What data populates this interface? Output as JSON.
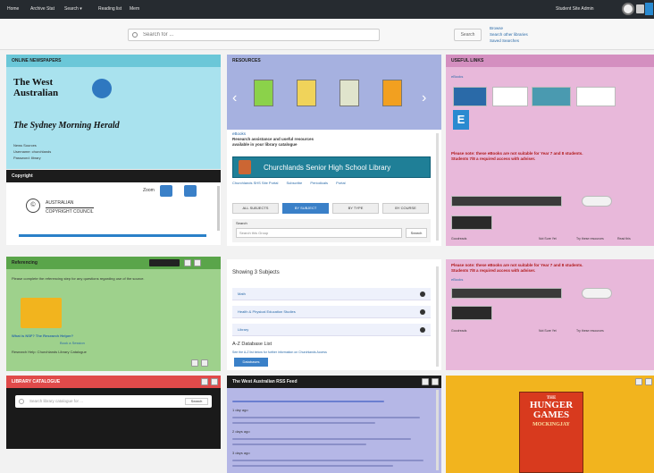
{
  "topbar": {
    "nav": [
      "Home",
      "Archive Stat",
      "Search ▾",
      "Reading list",
      "Mem"
    ],
    "right_text": "Student Site Admin"
  },
  "search": {
    "placeholder": "Search for ...",
    "button": "Search",
    "links": [
      "Browse",
      "Search other libraries",
      "Saved Searches"
    ]
  },
  "panels": {
    "newspapers": {
      "title": "ONLINE NEWSPAPERS",
      "logo1": "The West Australian",
      "logo2": "The Sydney Morning Herald",
      "lines": [
        "News Sources",
        "Username: churchlands",
        "Password: library"
      ]
    },
    "copyright": {
      "title": "Copyright",
      "zoom": "Zoom",
      "agency_line1": "AUSTRALIAN",
      "agency_line2": "COPYRIGHT COUNCIL"
    },
    "resources": {
      "title": "RESOURCES",
      "section": "eBooks",
      "sub1": "Research assistance and useful resources",
      "sub2": "available in your library catalogue",
      "library_name": "Churchlands Senior High School Library",
      "library_links": [
        "Churchlands SHS Site Portal",
        "Subscribe",
        "Periodicals",
        "Portal"
      ],
      "tabs": [
        "ALL SUBJECTS",
        "BY SUBJECT",
        "BY TYPE",
        "BY COURSE"
      ],
      "search_label": "Search",
      "search_placeholder": "Search this Group",
      "search_button": "Search"
    },
    "subjects": {
      "heading": "Showing 3 Subjects",
      "items": [
        "Math",
        "Health & Physical Education Studies",
        "Library"
      ],
      "az_title": "A-Z Database List",
      "az_line": "See the A-Z list below for further information on Churchlands Access",
      "az_button": "Databases"
    },
    "ebooks": {
      "title": "USEFUL LINKS",
      "link": "eBooks",
      "red_lines": [
        "Please note: these eBooks are not suitable for Year 7 and 8 students.",
        "Students 7/8 a required access with adviser."
      ],
      "bottom_labels": [
        "Goodreads",
        "Not Sure Yet",
        "Try these resources",
        "Read this"
      ]
    },
    "ebooks2": {
      "red_lines": [
        "Please note: these eBooks are not suitable for Year 7 and 8 students.",
        "Students 7/8 a required access with adviser."
      ],
      "link": "eBooks",
      "bottom_labels": [
        "Goodreads",
        "Not Sure Yet",
        "Try these resources"
      ]
    },
    "referencing": {
      "title": "Referencing",
      "line1": "Please complete the referencing step for any questions regarding use of the source.",
      "link": "What is NSF? The Research Helper?",
      "link2": "Book a Session",
      "line2": "Research Help: Churchlands Library Catalogue"
    },
    "catalogue": {
      "title": "LIBRARY CATALOGUE",
      "placeholder": "Search library catalogue for ...",
      "button": "Search"
    },
    "rss": {
      "title": "The West Australian RSS Feed",
      "items": [
        "1 day ago",
        "2 days ago",
        "3 days ago"
      ]
    },
    "book": {
      "title_line1": "THE",
      "title_line2": "HUNGER",
      "title_line3": "GAMES",
      "title_line4": "MOCKINGJAY"
    }
  },
  "colors": {
    "topbar": "#262b30",
    "newspaper_head": "#6bc7d8",
    "newspaper_body": "#a9e2ee",
    "resources_head": "#a6b1e0",
    "links_head": "#d48fc0",
    "links_body": "#e8b8da",
    "referencing": "#9ed18c",
    "catalogue_head": "#e04a4a",
    "rss_body": "#b5b7e6",
    "book_panel": "#f2b41e"
  }
}
